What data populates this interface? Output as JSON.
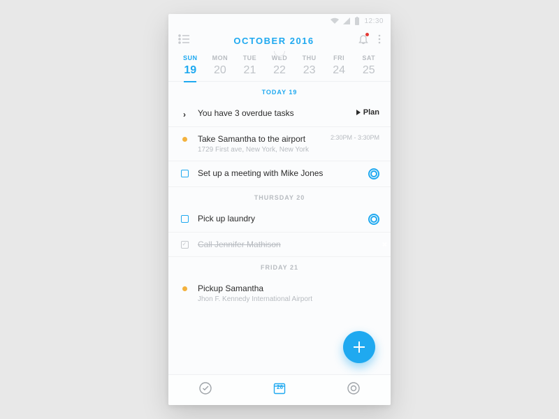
{
  "status": {
    "time": "12:30"
  },
  "header": {
    "title": "OCTOBER 2016"
  },
  "week": [
    {
      "dow": "SUN",
      "num": "19",
      "selected": true
    },
    {
      "dow": "MON",
      "num": "20",
      "selected": false
    },
    {
      "dow": "TUE",
      "num": "21",
      "selected": false
    },
    {
      "dow": "WED",
      "num": "22",
      "selected": false
    },
    {
      "dow": "THU",
      "num": "23",
      "selected": false
    },
    {
      "dow": "FRI",
      "num": "24",
      "selected": false
    },
    {
      "dow": "SAT",
      "num": "25",
      "selected": false
    }
  ],
  "sections": {
    "today_label": "TODAY 19",
    "thursday_label": "THURSDAY 20",
    "friday_label": "FRIDAY 21"
  },
  "overdue": {
    "text": "You have 3 overdue tasks",
    "action": "Plan"
  },
  "tasks": {
    "airport": {
      "title": "Take Samantha to the airport",
      "sub": "1729 First ave, New York, New York",
      "time": "2:30PM - 3:30PM"
    },
    "meeting": {
      "title": "Set up a meeting with Mike Jones"
    },
    "laundry": {
      "title": "Pick up laundry"
    },
    "call": {
      "title": "Call Jennifer Mathison"
    },
    "pickup": {
      "title": "Pickup Samantha",
      "sub": "Jhon F. Kennedy International Airport"
    }
  },
  "bottom_nav": {
    "calendar_badge": "26"
  }
}
